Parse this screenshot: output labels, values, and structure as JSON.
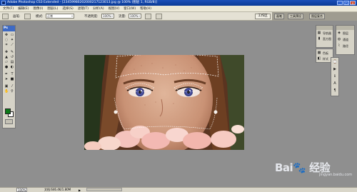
{
  "window": {
    "title": "Adobe Photoshop CS3 Extended - [23459980202000217123013.jpg @ 100% (图层 1, RGB/8)]",
    "controls": [
      "_",
      "□",
      "×"
    ]
  },
  "menu": {
    "items": [
      "文件(F)",
      "编辑(E)",
      "图像(I)",
      "图层(L)",
      "选择(S)",
      "滤镜(T)",
      "分析(A)",
      "视图(V)",
      "窗口(W)",
      "帮助(H)"
    ]
  },
  "options": {
    "mode_label": "模式:",
    "mode_value": "正常",
    "opacity_label": "不透明度:",
    "opacity_value": "100%",
    "flow_label": "流量:",
    "flow_value": "100%",
    "workspace_label": "工作区",
    "dock_tabs": [
      "画笔",
      "工具预设",
      "图层复合"
    ]
  },
  "toolbox": {
    "title": "Ps",
    "tools": [
      "move-tool",
      "marquee-tool",
      "lasso-tool",
      "magic-wand-tool",
      "crop-tool",
      "slice-tool",
      "healing-tool",
      "brush-tool",
      "stamp-tool",
      "history-brush-tool",
      "eraser-tool",
      "gradient-tool",
      "blur-tool",
      "dodge-tool",
      "pen-tool",
      "type-tool",
      "path-select-tool",
      "shape-tool",
      "notes-tool",
      "eyedropper-tool",
      "hand-tool",
      "zoom-tool"
    ],
    "foreground_color": "#0b7a18",
    "background_color": "#ffffff"
  },
  "panels": {
    "left_column": [
      "导航器",
      "直方图",
      "色板",
      "样式"
    ],
    "right_column": [
      "图层",
      "通道",
      "路径"
    ]
  },
  "status": {
    "zoom": "100%",
    "document": "文档:646.4K/1.80M"
  },
  "watermark": {
    "brand": "Bai",
    "brand_cn": "经验",
    "url": "jingyan.baidu.com"
  }
}
